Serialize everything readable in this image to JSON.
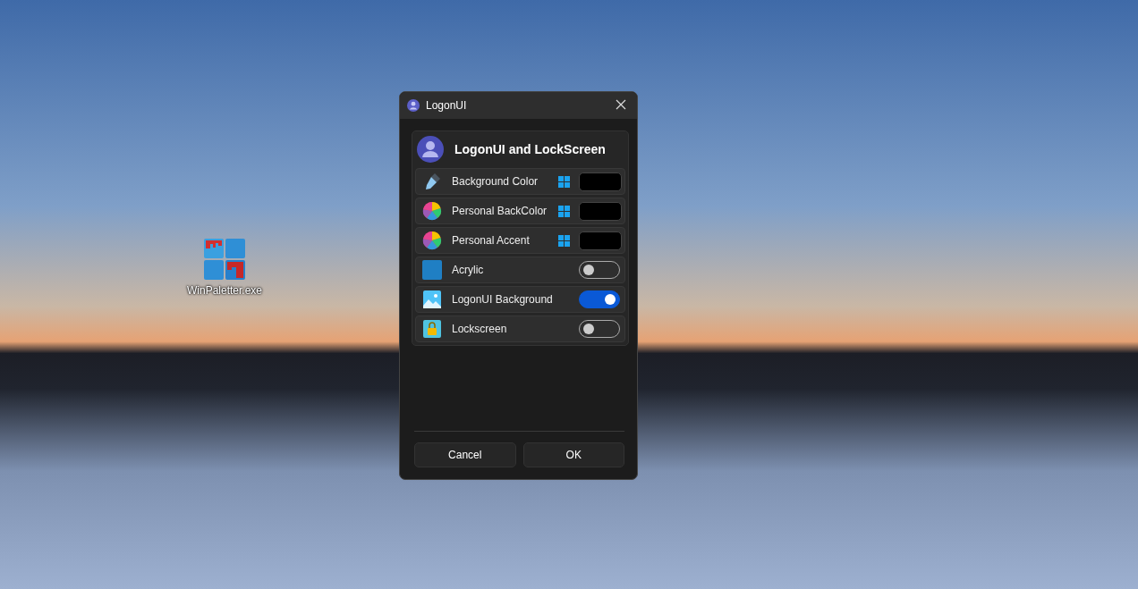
{
  "desktop": {
    "icons": [
      {
        "label": "WinPaletter.exe"
      }
    ]
  },
  "window": {
    "title": "LogonUI",
    "header": "LogonUI and LockScreen",
    "rows": [
      {
        "kind": "color",
        "label": "Background Color",
        "color": "#000000"
      },
      {
        "kind": "color",
        "label": "Personal BackColor",
        "color": "#000000"
      },
      {
        "kind": "color",
        "label": "Personal Accent",
        "color": "#000000"
      },
      {
        "kind": "toggle",
        "label": "Acrylic",
        "on": false
      },
      {
        "kind": "toggle",
        "label": "LogonUI Background",
        "on": true
      },
      {
        "kind": "toggle",
        "label": "Lockscreen",
        "on": false
      }
    ],
    "buttons": [
      "Cancel",
      "OK"
    ]
  }
}
